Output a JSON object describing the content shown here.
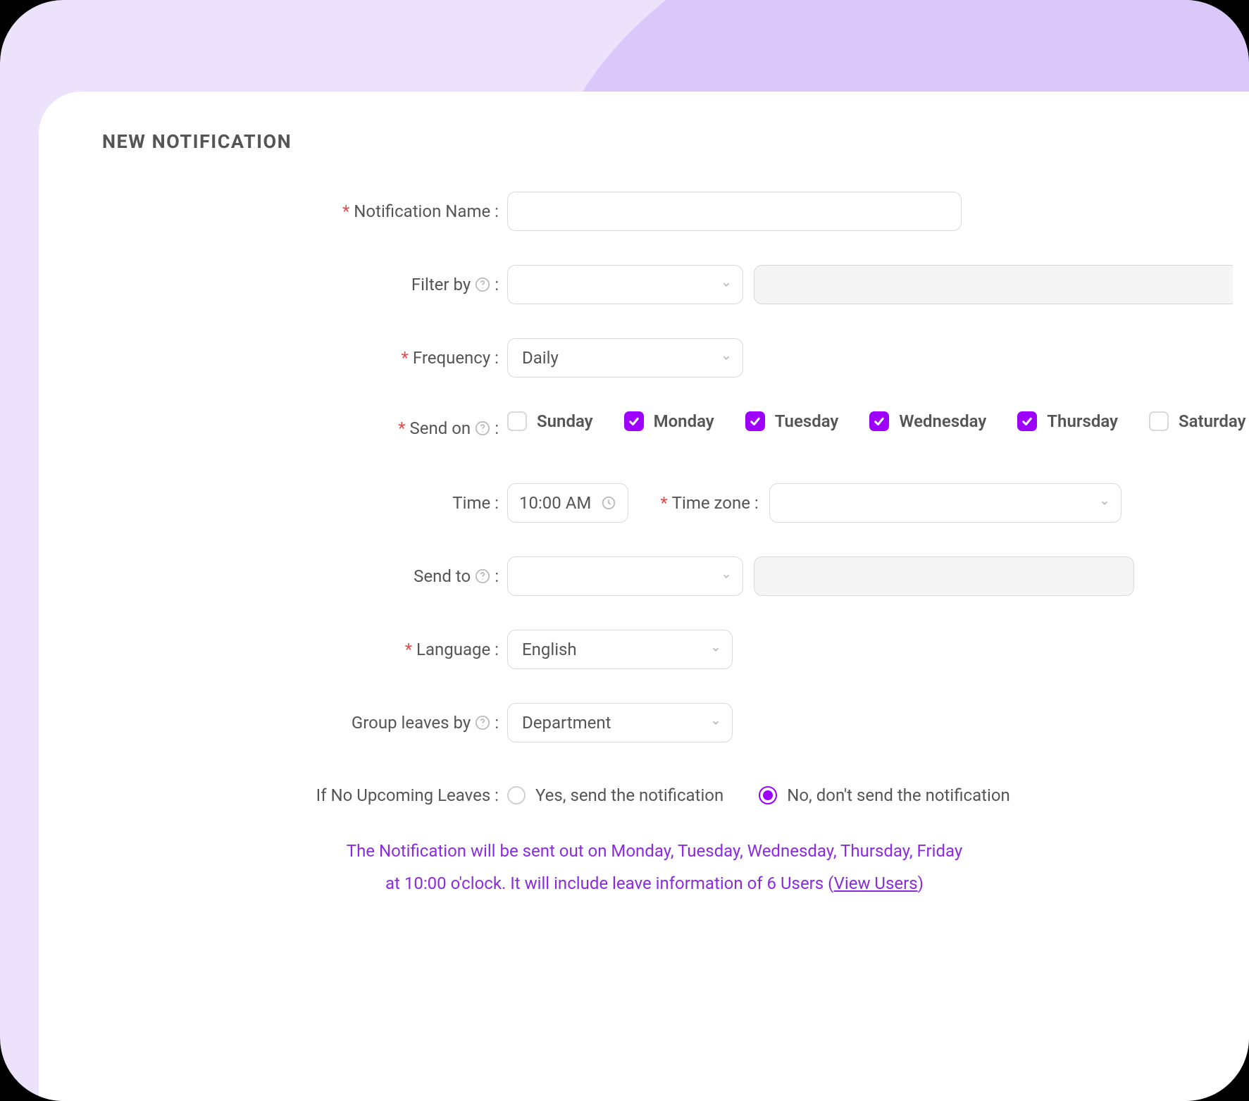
{
  "page_title": "NEW NOTIFICATION",
  "labels": {
    "notification_name": "Notification Name :",
    "filter_by": "Filter by",
    "frequency": "Frequency :",
    "send_on": "Send on",
    "time": "Time :",
    "timezone": "Time zone :",
    "send_to": "Send to",
    "language": "Language :",
    "group_leaves": "Group leaves by",
    "no_upcoming": "If No Upcoming Leaves :",
    "colon": ":"
  },
  "required_mark": "*",
  "notification_name_value": "",
  "filter_by_value": "",
  "frequency_value": "Daily",
  "days": [
    {
      "label": "Sunday",
      "checked": false
    },
    {
      "label": "Monday",
      "checked": true
    },
    {
      "label": "Tuesday",
      "checked": true
    },
    {
      "label": "Wednesday",
      "checked": true
    },
    {
      "label": "Thursday",
      "checked": true
    },
    {
      "label": "Saturday",
      "checked": false
    }
  ],
  "time_value": "10:00 AM",
  "timezone_value": "",
  "send_to_value": "",
  "language_value": "English",
  "group_leaves_value": "Department",
  "no_upcoming_options": {
    "yes": "Yes, send the notification",
    "no": "No, don't send the notification",
    "selected": "no"
  },
  "summary": {
    "line1": "The Notification will be sent out on Monday, Tuesday, Wednesday, Thursday, Friday",
    "line2_prefix": "at 10:00 o'clock. It will include leave information of 6 Users (",
    "link_text": "View Users",
    "line2_suffix": ")"
  }
}
